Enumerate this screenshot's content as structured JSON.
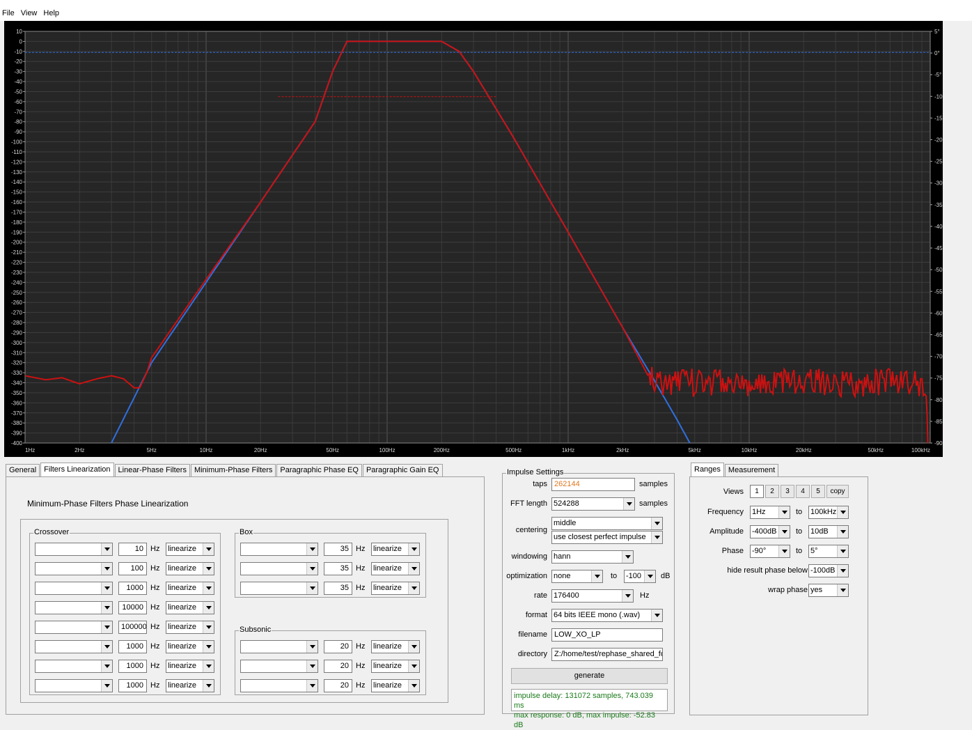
{
  "menu": [
    "File",
    "View",
    "Help"
  ],
  "chart_data": {
    "type": "line",
    "x_scale": "log",
    "xlim": [
      1,
      100000
    ],
    "ylim": [
      -400,
      10
    ],
    "y2lim": [
      -90,
      5
    ],
    "grid": true,
    "x_ticks": [
      "1Hz",
      "2Hz",
      "5Hz",
      "10Hz",
      "20Hz",
      "50Hz",
      "100Hz",
      "200Hz",
      "500Hz",
      "1kHz",
      "2kHz",
      "5kHz",
      "10kHz",
      "20kHz",
      "50kHz",
      "100kHz"
    ],
    "x_tick_values": [
      1,
      2,
      5,
      10,
      20,
      50,
      100,
      200,
      500,
      1000,
      2000,
      5000,
      10000,
      20000,
      50000,
      100000
    ],
    "y_ticks": [
      "10",
      "0",
      "-10",
      "-20",
      "-30",
      "-40",
      "-50",
      "-60",
      "-70",
      "-80",
      "-90",
      "-100",
      "-110",
      "-120",
      "-130",
      "-140",
      "-150",
      "-160",
      "-170",
      "-180",
      "-190",
      "-200",
      "-210",
      "-220",
      "-230",
      "-240",
      "-250",
      "-260",
      "-270",
      "-280",
      "-290",
      "-300",
      "-310",
      "-320",
      "-330",
      "-340",
      "-350",
      "-360",
      "-370",
      "-380",
      "-390",
      "-400"
    ],
    "y2_ticks": [
      "5°",
      "0°",
      "-5°",
      "-10°",
      "-15°",
      "-20°",
      "-25°",
      "-30°",
      "-35°",
      "-40°",
      "-45°",
      "-50°",
      "-55°",
      "-60°",
      "-65°",
      "-70°",
      "-75°",
      "-80°",
      "-85°",
      "-90°"
    ],
    "reference_lines": [
      {
        "axis": "y",
        "value": -11,
        "color": "#2f6fe0",
        "style": "dashed"
      },
      {
        "axis": "y",
        "value": -55,
        "from": 25,
        "to": 400,
        "color": "#cc1111",
        "style": "dashed"
      }
    ],
    "series": [
      {
        "color": "#2f6fe0",
        "x": [
          3,
          5,
          10,
          20,
          40,
          50,
          60,
          100,
          200,
          250,
          300,
          500,
          1000,
          2000,
          3000,
          4000,
          4700
        ],
        "y": [
          -400,
          -320,
          -240,
          -160,
          -80,
          -30,
          0,
          0,
          0,
          -10,
          -30,
          -96,
          -190,
          -285,
          -338,
          -377,
          -400
        ]
      },
      {
        "color": "#cc1111",
        "x": [
          1,
          1.3,
          1.6,
          2,
          2.5,
          3,
          3.5,
          4,
          4.3,
          4.7,
          5,
          10,
          20,
          40,
          50,
          60,
          100,
          200,
          250,
          300,
          500,
          1000,
          2000,
          2800,
          3000,
          5000,
          10000,
          20000,
          50000,
          95000,
          97000
        ],
        "y": [
          -333,
          -337,
          -335,
          -341,
          -336,
          -333,
          -336,
          -345,
          -345,
          -330,
          -315,
          -237,
          -160,
          -80,
          -30,
          0,
          0,
          0,
          -10,
          -30,
          -96,
          -190,
          -285,
          -335,
          -340,
          -340,
          -340,
          -340,
          -340,
          -340,
          -400
        ]
      }
    ]
  },
  "tabs": [
    "General",
    "Filters Linearization",
    "Linear-Phase Filters",
    "Minimum-Phase Filters",
    "Paragraphic Phase EQ",
    "Paragraphic Gain EQ"
  ],
  "panel_title": "Minimum-Phase Filters Phase Linearization",
  "unit_hz": "Hz",
  "crossover": {
    "title": "Crossover",
    "rows": [
      {
        "sel": "",
        "freq": "10",
        "mode": "linearize"
      },
      {
        "sel": "",
        "freq": "100",
        "mode": "linearize"
      },
      {
        "sel": "",
        "freq": "1000",
        "mode": "linearize"
      },
      {
        "sel": "",
        "freq": "10000",
        "mode": "linearize"
      },
      {
        "sel": "",
        "freq": "100000",
        "mode": "linearize"
      },
      {
        "sel": "",
        "freq": "1000",
        "mode": "linearize"
      },
      {
        "sel": "",
        "freq": "1000",
        "mode": "linearize"
      },
      {
        "sel": "",
        "freq": "1000",
        "mode": "linearize"
      }
    ]
  },
  "box": {
    "title": "Box",
    "rows": [
      {
        "sel": "",
        "freq": "35",
        "mode": "linearize"
      },
      {
        "sel": "",
        "freq": "35",
        "mode": "linearize"
      },
      {
        "sel": "",
        "freq": "35",
        "mode": "linearize"
      }
    ]
  },
  "subsonic": {
    "title": "Subsonic",
    "rows": [
      {
        "sel": "",
        "freq": "20",
        "mode": "linearize"
      },
      {
        "sel": "",
        "freq": "20",
        "mode": "linearize"
      },
      {
        "sel": "",
        "freq": "20",
        "mode": "linearize"
      }
    ]
  },
  "impulse": {
    "title": "Impulse Settings",
    "taps_label": "taps",
    "taps": "262144",
    "taps_unit": "samples",
    "fft_label": "FFT length",
    "fft": "524288",
    "fft_unit": "samples",
    "centering_label": "centering",
    "centering": "middle",
    "centering2": "use closest perfect impulse",
    "windowing_label": "windowing",
    "windowing": "hann",
    "optimization_label": "optimization",
    "optimization": "none",
    "opt_to": "to",
    "opt_val": "-100",
    "opt_unit": "dB",
    "rate_label": "rate",
    "rate": "176400",
    "rate_unit": "Hz",
    "format_label": "format",
    "format": "64 bits IEEE mono (.wav)",
    "filename_label": "filename",
    "filename": "LOW_XO_LP",
    "directory_label": "directory",
    "directory": "Z:/home/test/rephase_shared_fo",
    "generate": "generate",
    "status1": "impulse delay: 131072 samples, 743.039 ms",
    "status2": "max response: 0 dB, max impulse: -52.83 dB",
    "taps_color": "#e07820"
  },
  "ranges": {
    "tabs": [
      "Ranges",
      "Measurement"
    ],
    "views_label": "Views",
    "views": [
      "1",
      "2",
      "3",
      "4",
      "5"
    ],
    "copy": "copy",
    "to": "to",
    "frequency_label": "Frequency",
    "freq_from": "1Hz",
    "freq_to": "100kHz",
    "amplitude_label": "Amplitude",
    "amp_from": "-400dB",
    "amp_to": "10dB",
    "phase_label": "Phase",
    "phase_from": "-90°",
    "phase_to": "5°",
    "hide_label": "hide result phase below",
    "hide_val": "-100dB",
    "wrap_label": "wrap phase",
    "wrap_val": "yes"
  }
}
